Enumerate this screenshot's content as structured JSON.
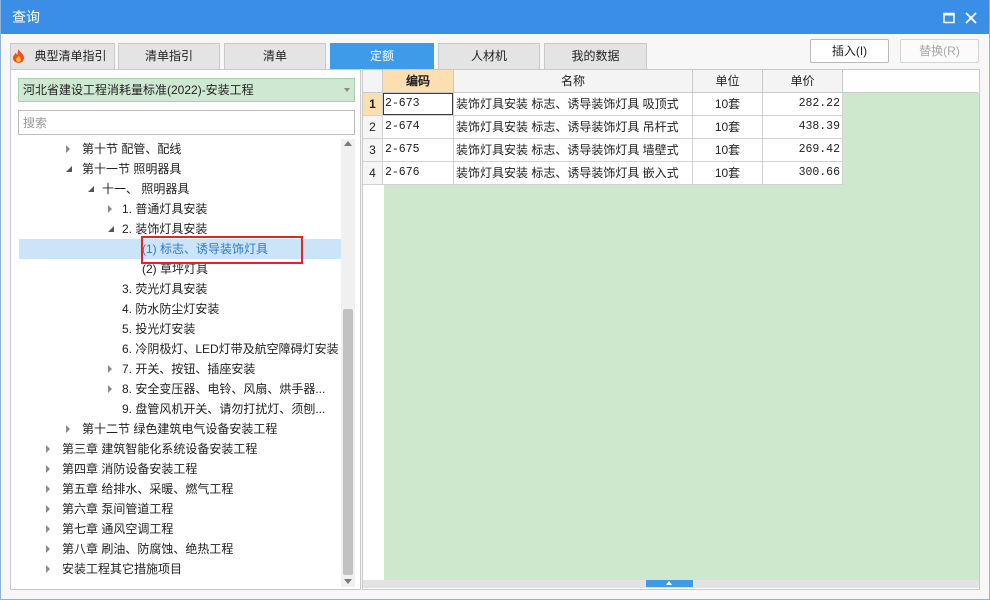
{
  "window": {
    "title": "查询"
  },
  "colors": {
    "title_bar": "#3a8ee6",
    "active_tab": "#3d9be9",
    "library_select_bg": "#cfe8d2",
    "grid_background": "#cde8cd",
    "selected_text": "#2a7ad0",
    "selected_row": "#cce4f7",
    "highlight_box": "#e0262a",
    "header_highlight": "#fcdfb0"
  },
  "tabs": [
    {
      "label": "典型清单指引",
      "icon": "flame-icon",
      "active": false
    },
    {
      "label": "清单指引",
      "active": false
    },
    {
      "label": "清单",
      "active": false
    },
    {
      "label": "定额",
      "active": true
    },
    {
      "label": "人材机",
      "active": false
    },
    {
      "label": "我的数据",
      "active": false
    }
  ],
  "actions": {
    "insert_label": "插入(I)",
    "replace_label": "替换(R)",
    "replace_disabled": true
  },
  "library_select": {
    "value": "河北省建设工程消耗量标准(2022)-安装工程"
  },
  "search": {
    "placeholder": "搜索"
  },
  "tree": [
    {
      "label": "第十节 配管、配线",
      "expanded": false
    },
    {
      "label": "第十一节 照明器具",
      "expanded": true
    },
    {
      "label": "十一、 照明器具",
      "expanded": true
    },
    {
      "label": "1. 普通灯具安装",
      "expanded": false
    },
    {
      "label": "2. 装饰灯具安装",
      "expanded": true
    },
    {
      "label": "(1) 标志、诱导装饰灯具",
      "selected": true
    },
    {
      "label": "(2) 草坪灯具"
    },
    {
      "label": "3. 荧光灯具安装"
    },
    {
      "label": "4. 防水防尘灯安装"
    },
    {
      "label": "5. 投光灯安装"
    },
    {
      "label": "6. 冷阴极灯、LED灯带及航空障碍灯安装"
    },
    {
      "label": "7. 开关、按钮、插座安装",
      "expanded": false
    },
    {
      "label": "8. 安全变压器、电铃、风扇、烘手器...",
      "expanded": false
    },
    {
      "label": "9. 盘管风机开关、请勿打扰灯、须刨..."
    },
    {
      "label": "第十二节 绿色建筑电气设备安装工程",
      "expanded": false
    },
    {
      "label": "第三章 建筑智能化系统设备安装工程",
      "expanded": false
    },
    {
      "label": "第四章 消防设备安装工程",
      "expanded": false
    },
    {
      "label": "第五章 给排水、采暖、燃气工程",
      "expanded": false
    },
    {
      "label": "第六章 泵间管道工程",
      "expanded": false
    },
    {
      "label": "第七章 通风空调工程",
      "expanded": false
    },
    {
      "label": "第八章 刷油、防腐蚀、绝热工程",
      "expanded": false
    },
    {
      "label": "安装工程其它措施项目",
      "expanded": false
    }
  ],
  "table": {
    "columns": {
      "code": "编码",
      "name": "名称",
      "unit": "单位",
      "price": "单价"
    },
    "rows": [
      {
        "no": "1",
        "code": "2-673",
        "name": "装饰灯具安装 标志、诱导装饰灯具 吸顶式",
        "unit": "10套",
        "price": "282.22"
      },
      {
        "no": "2",
        "code": "2-674",
        "name": "装饰灯具安装 标志、诱导装饰灯具 吊杆式",
        "unit": "10套",
        "price": "438.39"
      },
      {
        "no": "3",
        "code": "2-675",
        "name": "装饰灯具安装 标志、诱导装饰灯具 墙壁式",
        "unit": "10套",
        "price": "269.42"
      },
      {
        "no": "4",
        "code": "2-676",
        "name": "装饰灯具安装 标志、诱导装饰灯具 嵌入式",
        "unit": "10套",
        "price": "300.66"
      }
    ]
  }
}
